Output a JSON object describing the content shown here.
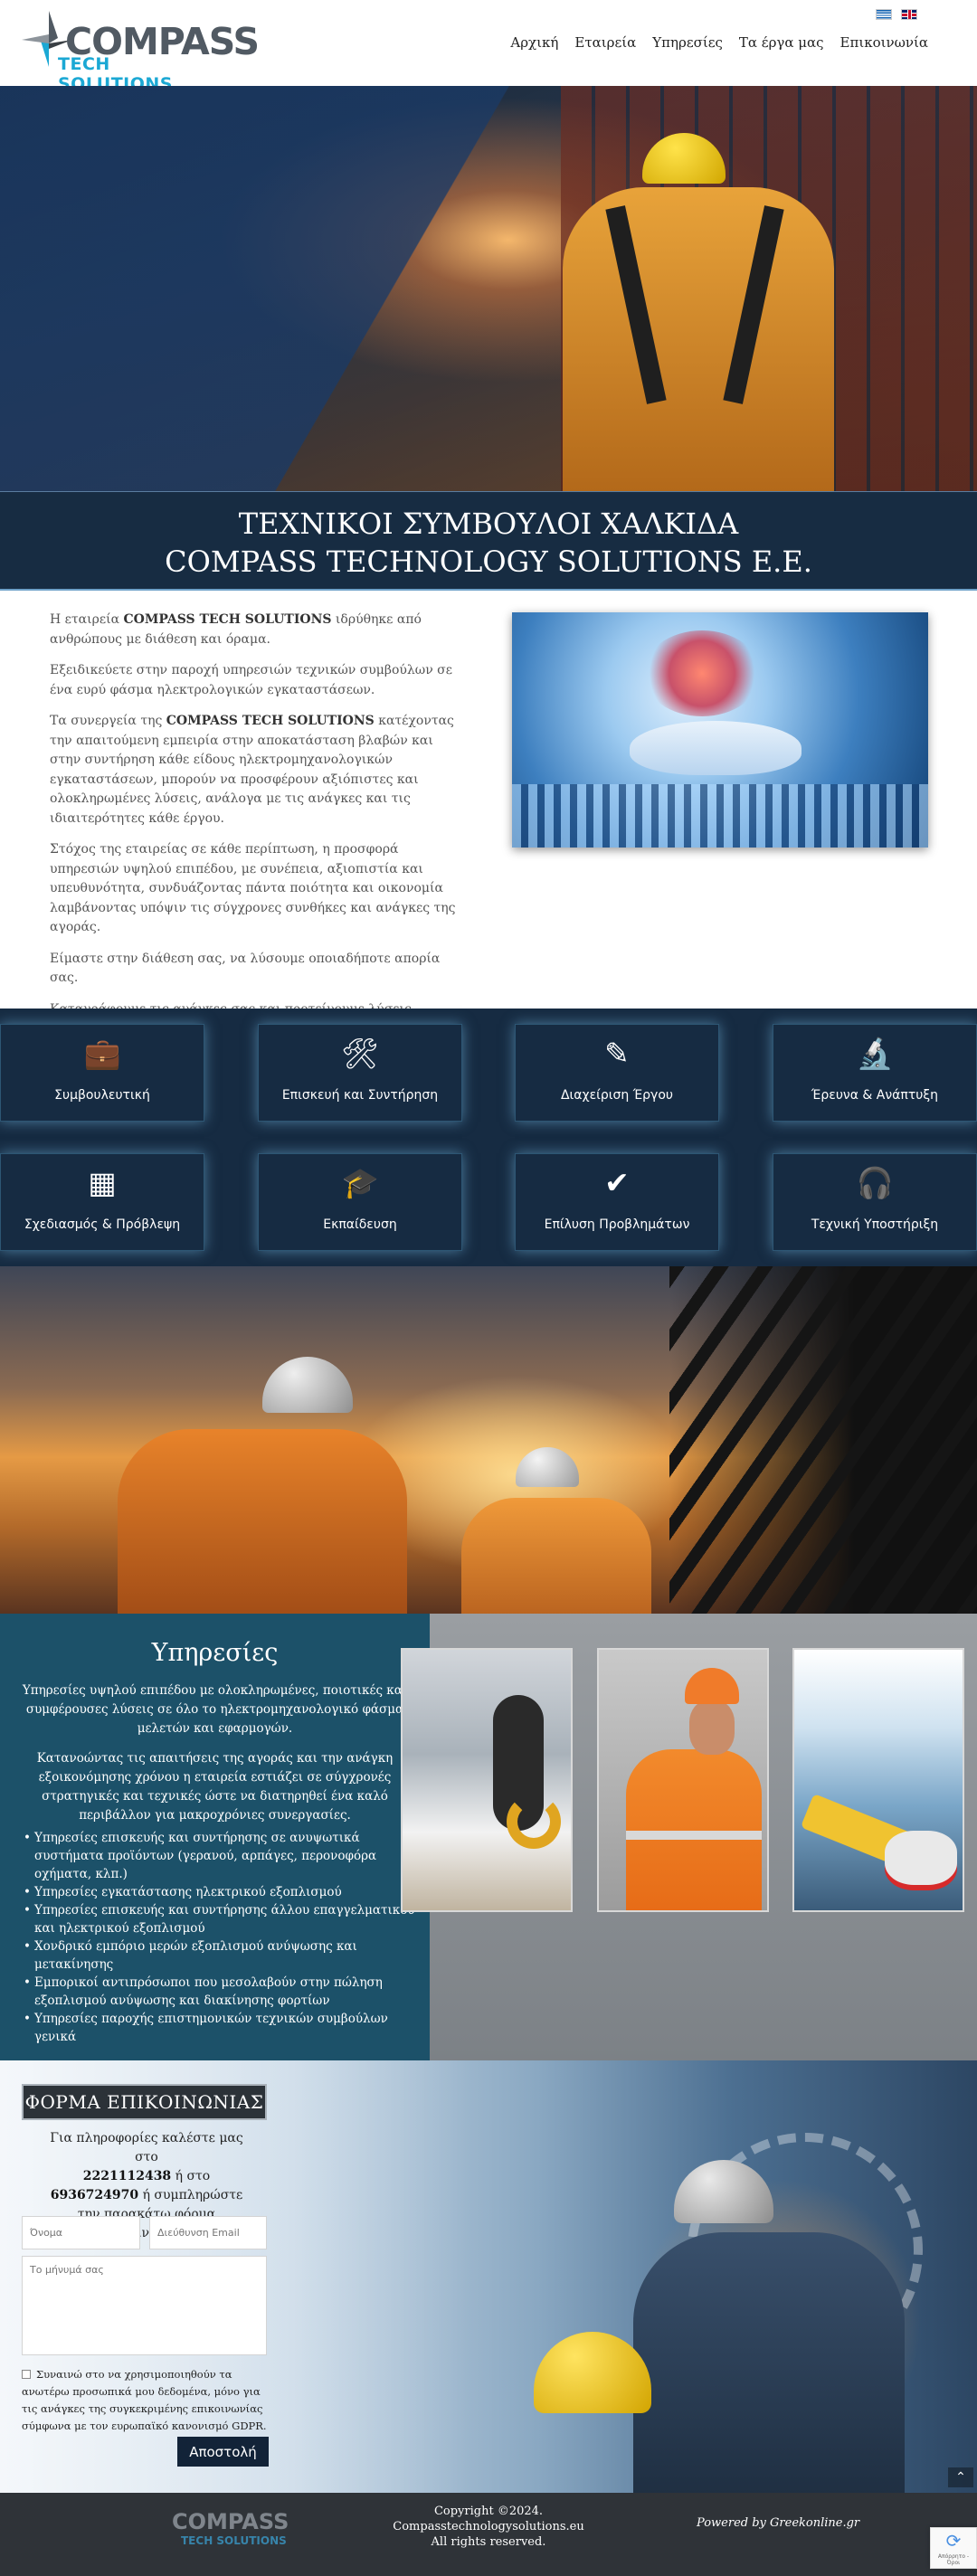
{
  "header": {
    "logo": {
      "word1": "COMPASS",
      "word2": "TECH SOLUTIONS"
    },
    "languages": [
      "Ελληνικά",
      "English"
    ],
    "nav": [
      "Αρχική",
      "Εταιρεία",
      "Υπηρεσίες",
      "Τα έργα μας",
      "Επικοινωνία"
    ]
  },
  "titlebar": {
    "line1": "ΤΕΧΝΙΚΟΙ ΣΥΜΒΟΥΛΟΙ ΧΑΛΚΙΔΑ",
    "line2": "COMPASS TECHNOLOGY SOLUTIONS E.E."
  },
  "intro": {
    "p1_pre": "Η εταιρεία ",
    "p1_bold": "COMPASS TECH SOLUTIONS",
    "p1_post": " ιδρύθηκε από ανθρώπους με διάθεση και όραμα.",
    "p2": "Εξειδικεύετε στην παροχή υπηρεσιών τεχνικών συμβούλων σε ένα ευρύ φάσμα ηλεκτρολογικών εγκαταστάσεων.",
    "p3_pre": "Τα συνεργεία της ",
    "p3_bold": "COMPASS TECH SOLUTIONS",
    "p3_post": " κατέχοντας την απαιτούμενη εμπειρία στην αποκατάσταση βλαβών και στην συντήρηση κάθε είδους ηλεκτρομηχανολογικών εγκαταστάσεων, μπορούν να προσφέρουν αξιόπιστες και ολοκληρωμένες λύσεις, ανάλογα με τις ανάγκες και τις ιδιαιτερότητες κάθε έργου.",
    "p4": "Στόχος της εταιρείας σε κάθε περίπτωση, η προσφορά υπηρεσιών υψηλού επιπέδου, με συνέπεια, αξιοπιστία και υπευθυνότητα, συνδυάζοντας πάντα ποιότητα και οικονομία λαμβάνοντας υπόψιν τις σύγχρονες συνθήκες και ανάγκες της αγοράς.",
    "p5": "Είμαστε στην διάθεση σας, να λύσουμε οποιαδήποτε απορία σας.",
    "p6": "Καταγράφουμε τις ανάγκες σας και προτείνουμε λύσεις φτιαγμένες στα μέτρα σας."
  },
  "tiles": [
    {
      "icon": "briefcase-icon",
      "glyph": "💼",
      "label": "Συμβουλευτική"
    },
    {
      "icon": "tools-icon",
      "glyph": "🛠",
      "label": "Επισκευή και Συντήρηση"
    },
    {
      "icon": "pencil-ruler-icon",
      "glyph": "✎",
      "label": "Διαχείριση Έργου"
    },
    {
      "icon": "microscope-icon",
      "glyph": "🔬",
      "label": "Έρευνα & Ανάπτυξη"
    },
    {
      "icon": "swatchbook-icon",
      "glyph": "▦",
      "label": "Σχεδιασμός & Πρόβλεψη"
    },
    {
      "icon": "teacher-icon",
      "glyph": "🎓",
      "label": "Εκπαίδευση"
    },
    {
      "icon": "checkmark-icon",
      "glyph": "✔",
      "label": "Επίλυση Προβλημάτων"
    },
    {
      "icon": "headset-icon",
      "glyph": "🎧",
      "label": "Τεχνική Υποστήριξη"
    }
  ],
  "services": {
    "title": "Υπηρεσίες",
    "p1": "Υπηρεσίες υψηλού επιπέδου με ολοκληρωμένες, ποιοτικές και συμφέρουσες λύσεις σε όλο το ηλεκτρομηχανολογικό φάσμα μελετών και εφαρμογών.",
    "p2": "Κατανοώντας τις απαιτήσεις της αγοράς και την ανάγκη εξοικονόμησης χρόνου η εταιρεία εστιάζει σε σύγχρονές στρατηγικές και τεχνικές ώστε να διατηρηθεί ένα καλό περιβάλλον για μακροχρόνιες συνεργασίες.",
    "items": [
      "Υπηρεσίες επισκευής και συντήρησης σε ανυψωτικά συστήματα προϊόντων (γερανού, αρπάγες, περονοφόρα οχήματα, κλπ.)",
      "Υπηρεσίες εγκατάστασης ηλεκτρικού εξοπλισμού",
      "Υπηρεσίες επισκευής και συντήρησης άλλου επαγγελματικού και ηλεκτρικού εξοπλισμού",
      "Χονδρικό εμπόριο μερών εξοπλισμού ανύψωσης και μετακίνησης",
      "Εμπορικοί αντιπρόσωποι που μεσολαβούν στην πώληση εξοπλισμού ανύψωσης και διακίνησης φορτίων",
      "Υπηρεσίες παροχής επιστημονικών τεχνικών συμβούλων γενικά"
    ]
  },
  "contact": {
    "title": "ΦΟΡΜΑ ΕΠΙΚΟΙΝΩΝΙΑΣ",
    "info_pre": "Για πληροφορίες καλέστε μας στο",
    "phone1": "2221112438",
    "info_mid": " ή στο ",
    "phone2": "6936724970",
    "info_post": " ή συμπληρώστε την παρακάτω φόρμα επικοινωνίας.",
    "name_placeholder": "Όνομα",
    "email_placeholder": "Διεύθυνση Email",
    "message_placeholder": "Το μήνυμά σας",
    "consent": "Συναινώ στο να χρησιμοποιηθούν τα ανωτέρω προσωπικά μου δεδομένα, μόνο για τις ανάγκες της συγκεκριμένης επικοινωνίας σύμφωνα με τον ευρωπαϊκό κανονισμό GDPR.",
    "submit": "Αποστολή"
  },
  "footer": {
    "logo_word1": "COMPASS",
    "logo_word2": "TECH SOLUTIONS",
    "copyright": "Copyright ©2024.",
    "domain": "Compasstechnologysolutions.eu",
    "rights": "All rights reserved.",
    "powered": "Powered by Greekonline.gr"
  },
  "recaptcha": {
    "text": "Απόρρητο - Όροι"
  },
  "colors": {
    "brand_blue": "#1ba8d4",
    "navy": "#172c42",
    "teal_panel": "#1c5169"
  }
}
